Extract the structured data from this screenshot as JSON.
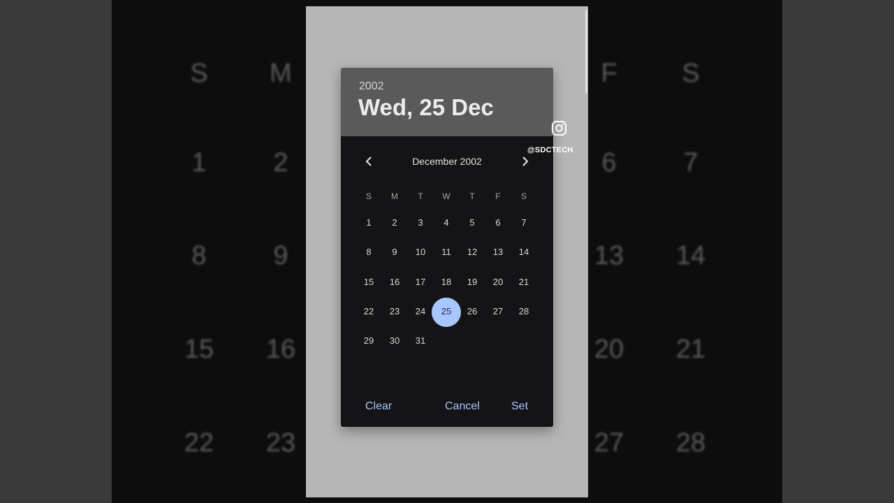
{
  "background": {
    "weekday_letters": [
      "S",
      "M",
      "",
      "",
      "",
      "F",
      "S"
    ],
    "rows": [
      [
        "1",
        "2",
        "",
        "",
        "",
        "6",
        "7"
      ],
      [
        "8",
        "9",
        "",
        "",
        "",
        "13",
        "14"
      ],
      [
        "15",
        "16",
        "",
        "",
        "",
        "20",
        "21"
      ],
      [
        "22",
        "23",
        "",
        "",
        "",
        "27",
        "28"
      ]
    ]
  },
  "dialog": {
    "header_year": "2002",
    "header_date": "Wed, 25 Dec",
    "month_label": "December 2002",
    "weekdays": [
      "S",
      "M",
      "T",
      "W",
      "T",
      "F",
      "S"
    ],
    "days": [
      "1",
      "2",
      "3",
      "4",
      "5",
      "6",
      "7",
      "8",
      "9",
      "10",
      "11",
      "12",
      "13",
      "14",
      "15",
      "16",
      "17",
      "18",
      "19",
      "20",
      "21",
      "22",
      "23",
      "24",
      "25",
      "26",
      "27",
      "28",
      "29",
      "30",
      "31"
    ],
    "selected_day": "25",
    "actions": {
      "clear": "Clear",
      "cancel": "Cancel",
      "set": "Set"
    }
  },
  "overlay": {
    "handle": "@SDCTECH",
    "icon": "instagram-icon"
  },
  "colors": {
    "header_bg": "#5a5a5a",
    "dialog_bg": "#141416",
    "accent": "#a8c4ff",
    "selected_circle": "#a9c7ff"
  }
}
